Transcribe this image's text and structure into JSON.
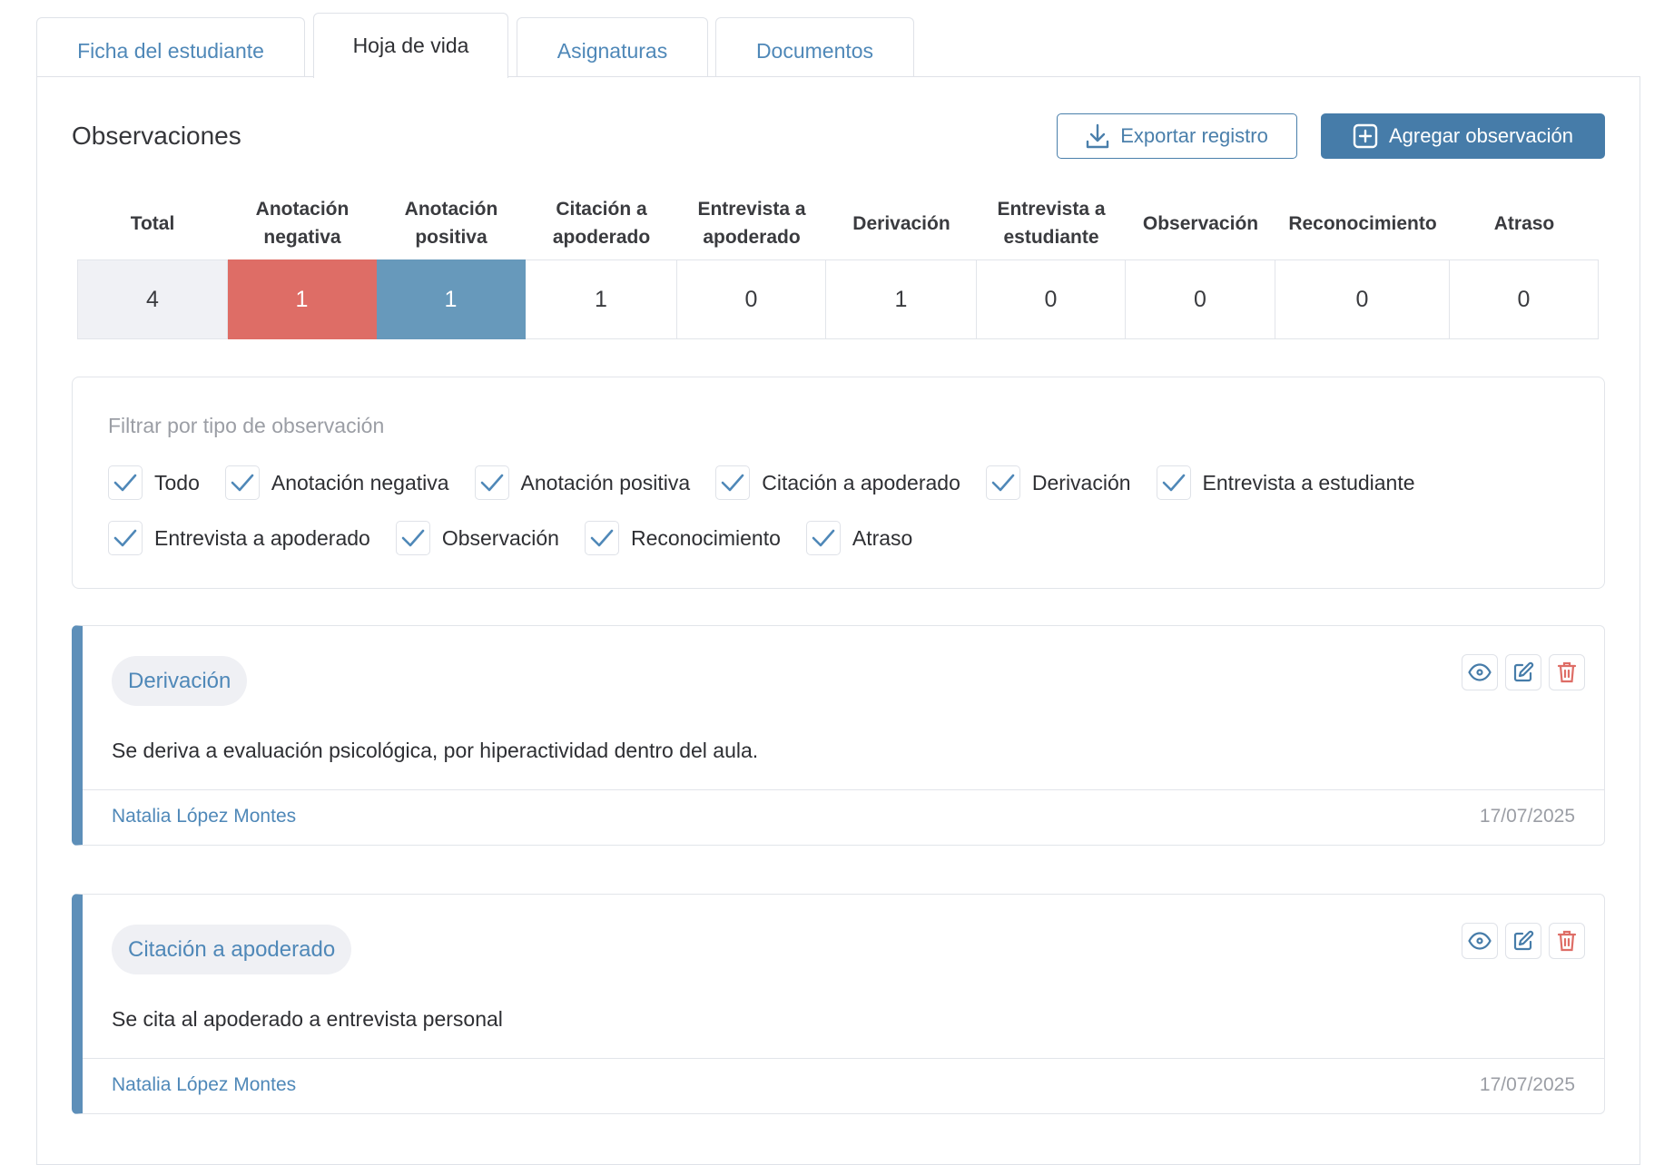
{
  "tabs": [
    "Ficha del estudiante",
    "Hoja de vida",
    "Asignaturas",
    "Documentos"
  ],
  "title": "Observaciones",
  "export_label": "Exportar registro",
  "add_label": "Agregar observación",
  "stats": [
    {
      "label": "Total",
      "value": "4"
    },
    {
      "label": "Anotación negativa",
      "value": "1"
    },
    {
      "label": "Anotación positiva",
      "value": "1"
    },
    {
      "label": "Citación a apoderado",
      "value": "1"
    },
    {
      "label": "Entrevista a apoderado",
      "value": "0"
    },
    {
      "label": "Derivación",
      "value": "1"
    },
    {
      "label": "Entrevista a estudiante",
      "value": "0"
    },
    {
      "label": "Observación",
      "value": "0"
    },
    {
      "label": "Reconocimiento",
      "value": "0"
    },
    {
      "label": "Atraso",
      "value": "0"
    }
  ],
  "filter": {
    "label": "Filtrar por tipo de observación",
    "row1": [
      "Todo",
      "Anotación negativa",
      "Anotación positiva",
      "Citación a apoderado",
      "Derivación",
      "Entrevista a estudiante"
    ],
    "row2": [
      "Entrevista a apoderado",
      "Observación",
      "Reconocimiento",
      "Atraso"
    ]
  },
  "cards": [
    {
      "type": "Derivación",
      "text": "Se deriva a evaluación psicológica, por hiperactividad dentro del aula.",
      "author": "Natalia López Montes",
      "date": "17/07/2025"
    },
    {
      "type": "Citación a apoderado",
      "text": "Se cita al apoderado a entrevista personal",
      "author": "Natalia López Montes",
      "date": "17/07/2025"
    }
  ],
  "colors": {
    "primary": "#467ca9",
    "negative": "#de6d66",
    "positive": "#6799bb",
    "total_bg": "#f0f1f5"
  }
}
